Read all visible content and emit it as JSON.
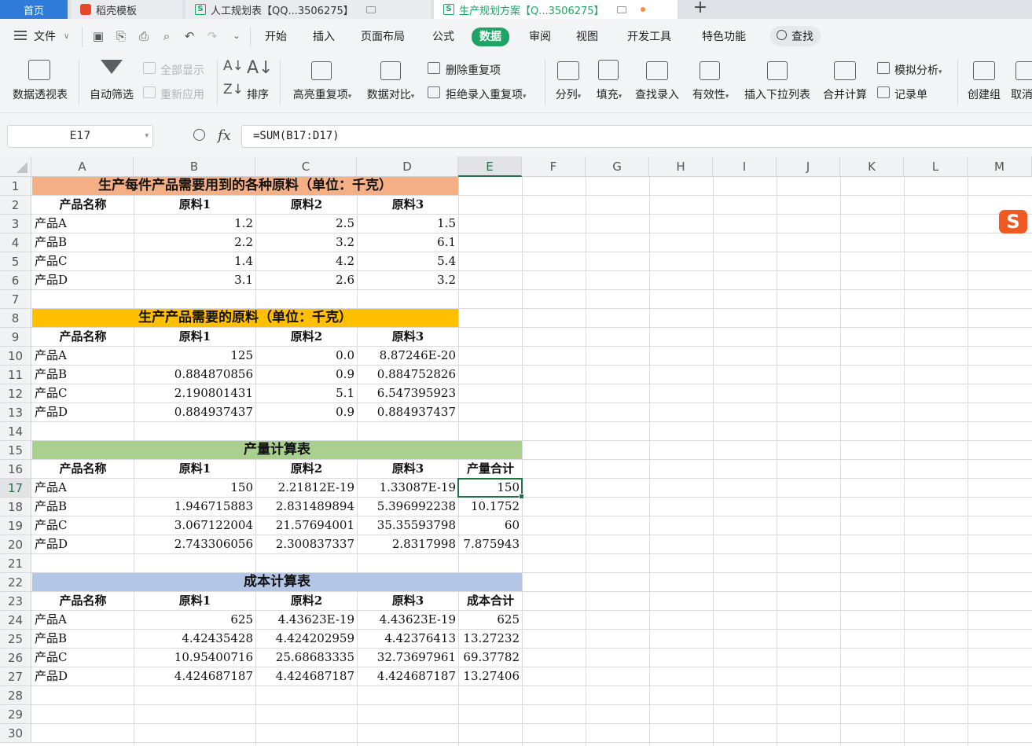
{
  "tabs": {
    "home": "首页",
    "template": "稻壳模板",
    "file1": "人工规划表【QQ...3506275】",
    "file2": "生产规划方案【Q...3506275】",
    "add": "+"
  },
  "menu": {
    "file": "文件",
    "items": [
      "开始",
      "插入",
      "页面布局",
      "公式",
      "数据",
      "审阅",
      "视图",
      "开发工具",
      "特色功能"
    ],
    "active": "数据",
    "search": "查找"
  },
  "ribbon": {
    "pivot": "数据透视表",
    "autofilter": "自动筛选",
    "show_all": "全部显示",
    "reapply": "重新应用",
    "sort": "排序",
    "highlight_dup": "高亮重复项",
    "compare": "数据对比",
    "delete_dup": "删除重复项",
    "reject_dup": "拒绝录入重复项",
    "split": "分列",
    "fill": "填充",
    "lookup": "查找录入",
    "validity": "有效性",
    "dropdown": "插入下拉列表",
    "consolidate": "合并计算",
    "whatif": "模拟分析",
    "record": "记录单",
    "group": "创建组",
    "ungroup": "取消"
  },
  "formula_bar": {
    "namebox": "E17",
    "fx": "fx",
    "formula": "=SUM(B17:D17)"
  },
  "sheet": {
    "columns": [
      "A",
      "B",
      "C",
      "D",
      "E",
      "F",
      "G",
      "H",
      "I",
      "J",
      "K",
      "L",
      "M"
    ],
    "rows": [
      "1",
      "2",
      "3",
      "4",
      "5",
      "6",
      "7",
      "8",
      "9",
      "10",
      "11",
      "12",
      "13",
      "14",
      "15",
      "16",
      "17",
      "18",
      "19",
      "20",
      "21",
      "22",
      "23",
      "24",
      "25",
      "26",
      "27",
      "28",
      "29",
      "30"
    ],
    "selected_cell": "E17",
    "sections": {
      "s1": {
        "title": "生产每件产品需要用到的各种原料（单位：千克）",
        "color": "#f4b084",
        "headers": [
          "产品名称",
          "原料1",
          "原料2",
          "原料3"
        ],
        "rows": [
          [
            "产品A",
            "1.2",
            "2.5",
            "1.5"
          ],
          [
            "产品B",
            "2.2",
            "3.2",
            "6.1"
          ],
          [
            "产品C",
            "1.4",
            "4.2",
            "5.4"
          ],
          [
            "产品D",
            "3.1",
            "2.6",
            "3.2"
          ]
        ]
      },
      "s2": {
        "title": "生产产品需要的原料（单位：千克）",
        "color": "#ffc000",
        "headers": [
          "产品名称",
          "原料1",
          "原料2",
          "原料3"
        ],
        "rows": [
          [
            "产品A",
            "125",
            "0.0",
            "8.87246E-20"
          ],
          [
            "产品B",
            "0.884870856",
            "0.9",
            "0.884752826"
          ],
          [
            "产品C",
            "2.190801431",
            "5.1",
            "6.547395923"
          ],
          [
            "产品D",
            "0.884937437",
            "0.9",
            "0.884937437"
          ]
        ]
      },
      "s3": {
        "title": "产量计算表",
        "color": "#a9d08e",
        "headers": [
          "产品名称",
          "原料1",
          "原料2",
          "原料3",
          "产量合计"
        ],
        "rows": [
          [
            "产品A",
            "150",
            "2.21812E-19",
            "1.33087E-19",
            "150"
          ],
          [
            "产品B",
            "1.946715883",
            "2.831489894",
            "5.396992238",
            "10.1752"
          ],
          [
            "产品C",
            "3.067122004",
            "21.57694001",
            "35.35593798",
            "60"
          ],
          [
            "产品D",
            "2.743306056",
            "2.300837337",
            "2.8317998",
            "7.875943"
          ]
        ]
      },
      "s4": {
        "title": "成本计算表",
        "color": "#b4c6e7",
        "headers": [
          "产品名称",
          "原料1",
          "原料2",
          "原料3",
          "成本合计"
        ],
        "rows": [
          [
            "产品A",
            "625",
            "4.43623E-19",
            "4.43623E-19",
            "625"
          ],
          [
            "产品B",
            "4.42435428",
            "4.424202959",
            "4.42376413",
            "13.27232"
          ],
          [
            "产品C",
            "10.95400716",
            "25.68683335",
            "32.73697961",
            "69.37782"
          ],
          [
            "产品D",
            "4.424687187",
            "4.424687187",
            "4.424687187",
            "13.27406"
          ]
        ]
      }
    }
  },
  "sogou_badge": "S",
  "colors": {
    "accent": "#21a366",
    "selection": "#217346",
    "home_tab": "#2f7bd9"
  }
}
